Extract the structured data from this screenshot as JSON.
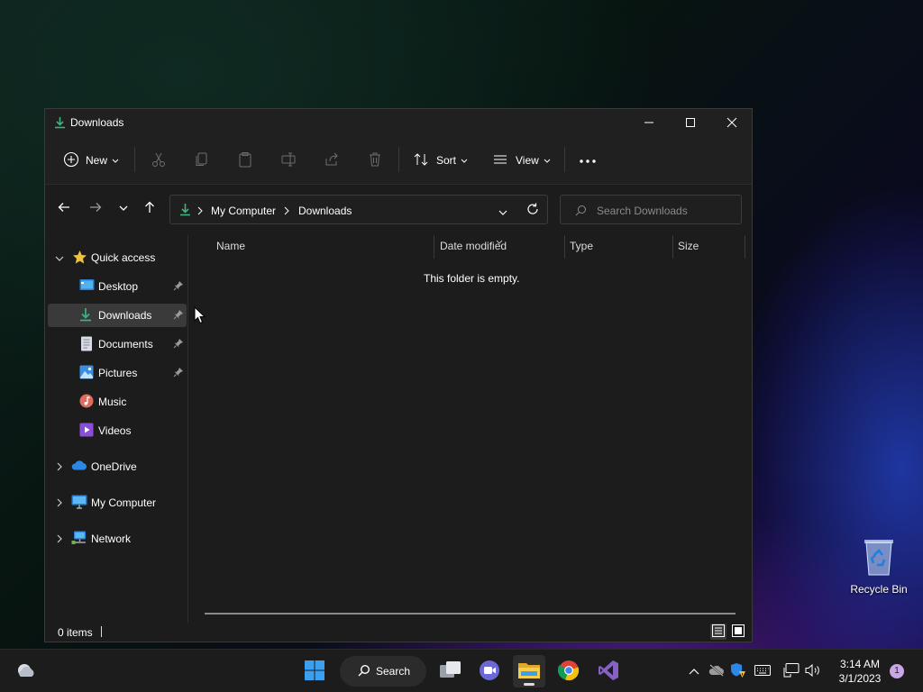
{
  "window": {
    "title": "Downloads"
  },
  "toolbar": {
    "new_label": "New",
    "sort_label": "Sort",
    "view_label": "View"
  },
  "address": {
    "crumbs": [
      "My Computer",
      "Downloads"
    ]
  },
  "search": {
    "placeholder": "Search Downloads"
  },
  "navpane": {
    "quick_access": "Quick access",
    "items": [
      {
        "label": "Desktop",
        "pinned": true
      },
      {
        "label": "Downloads",
        "pinned": true,
        "selected": true
      },
      {
        "label": "Documents",
        "pinned": true
      },
      {
        "label": "Pictures",
        "pinned": true
      },
      {
        "label": "Music",
        "pinned": false
      },
      {
        "label": "Videos",
        "pinned": false
      }
    ],
    "roots": [
      "OneDrive",
      "My Computer",
      "Network"
    ]
  },
  "columns": [
    "Name",
    "Date modified",
    "Type",
    "Size"
  ],
  "content": {
    "empty_message": "This folder is empty."
  },
  "status": {
    "item_count": "0 items"
  },
  "desktop": {
    "recycle_bin_label": "Recycle Bin"
  },
  "taskbar": {
    "search_label": "Search",
    "time": "3:14 AM",
    "date": "3/1/2023",
    "notification_count": "1"
  },
  "colors": {
    "accent_green": "#3fb27f",
    "folder_yellow": "#f0c23a"
  }
}
